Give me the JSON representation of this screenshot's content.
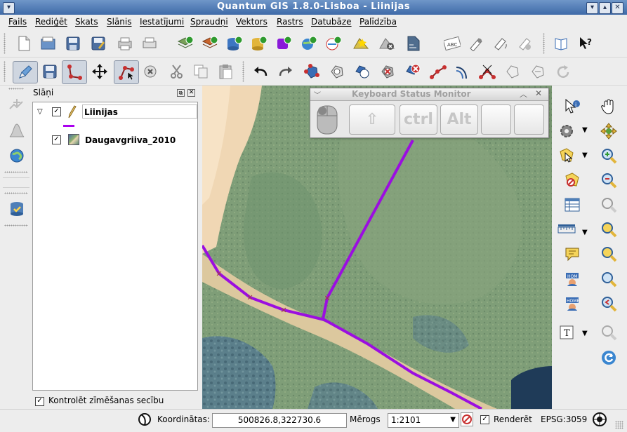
{
  "window": {
    "title": "Quantum GIS 1.8.0-Lisboa - Liinijas",
    "menu_icon": "chevron-down-icon",
    "controls": [
      "minimize-icon",
      "maximize-icon",
      "close-icon"
    ]
  },
  "menubar": {
    "items": [
      "Fails",
      "Rediģēt",
      "Skats",
      "Slānis",
      "Iestatījumi",
      "Spraudņi",
      "Vektors",
      "Rastrs",
      "Datubāze",
      "Palīdzība"
    ]
  },
  "layers_panel": {
    "title": "Slāņi",
    "layers": [
      {
        "name": "Liinijas",
        "checked": true,
        "icon": "pencil-icon",
        "symbol_color": "#aa00ee"
      },
      {
        "name": "Daugavgriiva_2010",
        "checked": true,
        "icon": "raster-icon"
      }
    ],
    "render_order_label": "Kontrolēt zīmēšanas secību",
    "render_order_checked": true
  },
  "keyboard_monitor": {
    "title": "Keyboard Status Monitor",
    "keys": [
      "ctrl",
      "Alt"
    ]
  },
  "statusbar": {
    "coordinates_label": "Koordinātas:",
    "coordinates_value": "500826.8,322730.6",
    "scale_label": "Mērogs",
    "scale_value": "1:2101",
    "render_label": "Renderēt",
    "render_checked": true,
    "crs": "EPSG:3059"
  },
  "colors": {
    "line": "#9b0ee0",
    "titlebar": "#3e6aa8"
  }
}
